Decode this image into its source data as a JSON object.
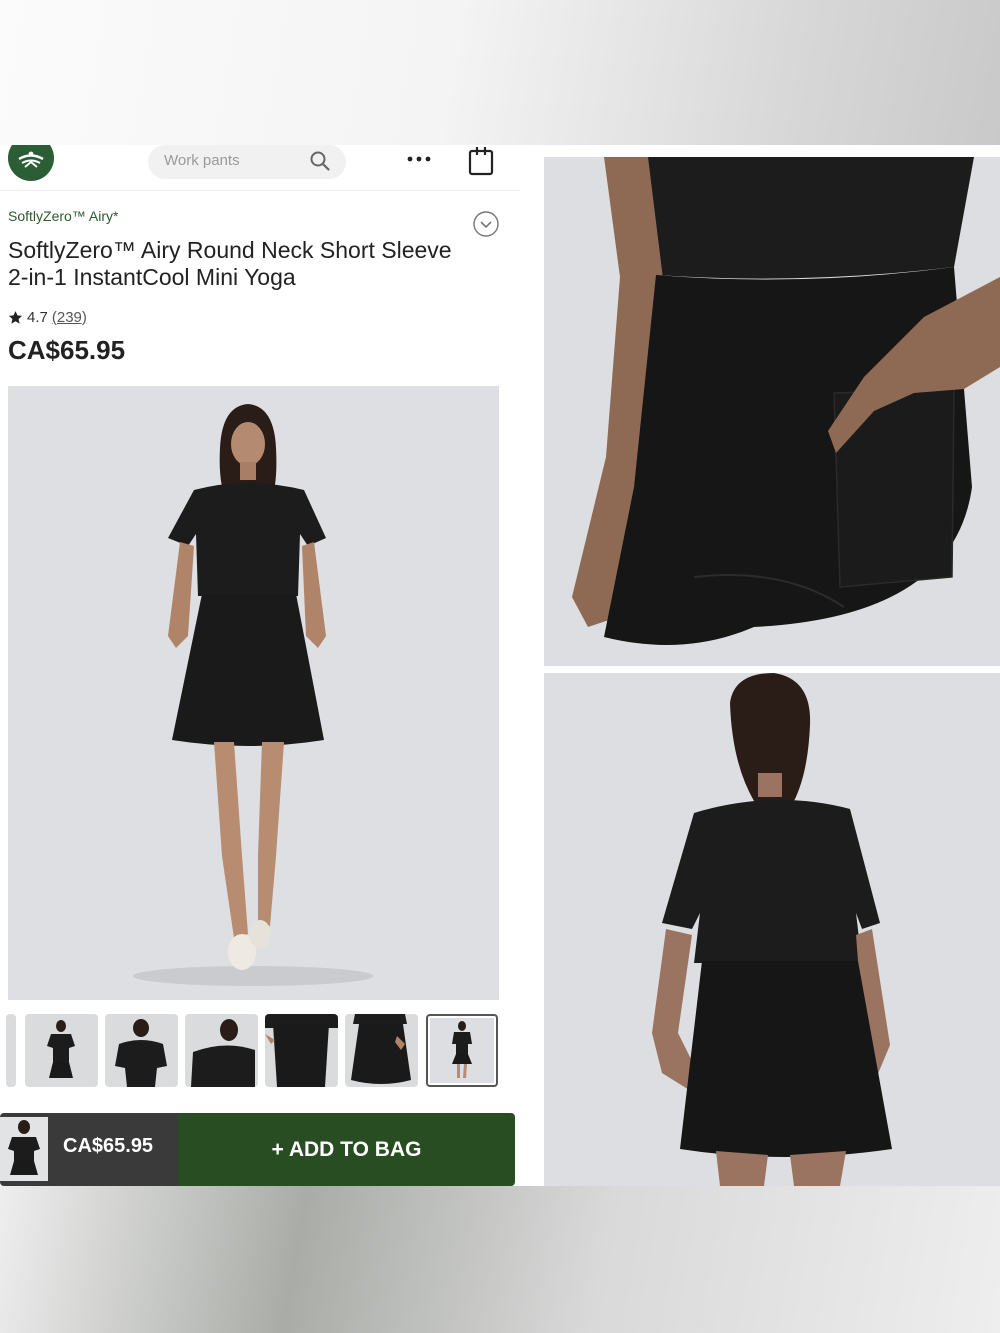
{
  "search": {
    "placeholder": "Work pants"
  },
  "product": {
    "brand": "SoftlyZero™ Airy*",
    "title": "SoftlyZero™ Airy Round Neck Short Sleeve 2-in-1 InstantCool Mini Yoga",
    "rating": "4.7",
    "review_count": "(239)",
    "price": "CA$65.95",
    "color": "black"
  },
  "gallery": {
    "thumbnail_count": 7,
    "selected_index": 6
  },
  "bottom_bar": {
    "price": "CA$65.95",
    "add_label": "+ ADD TO BAG"
  },
  "icons": {
    "logo": "brand-logo-icon",
    "search": "search-icon",
    "more": "more-horizontal-icon",
    "bag": "shopping-bag-icon",
    "collapse": "chevron-circle-icon",
    "rating": "star-icon"
  },
  "colors": {
    "brand_green": "#2c5e35",
    "add_button": "#284d22",
    "price_bar": "#3a3a3a"
  }
}
